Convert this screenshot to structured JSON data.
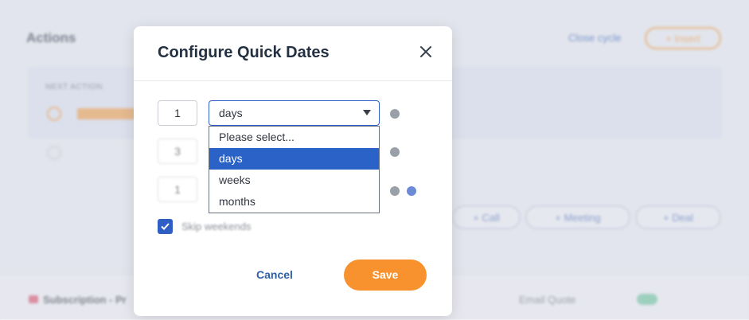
{
  "background": {
    "actions_title": "Actions",
    "close_cycle": "Close cycle",
    "insert": "+ Insert",
    "next_action_label": "NEXT ACTION",
    "pills": [
      "+ Call",
      "+ Meeting",
      "+ Deal"
    ],
    "subscription": "Subscription - Pr",
    "email_quote": "Email Quote"
  },
  "modal": {
    "title": "Configure Quick Dates",
    "close_icon": "close-icon",
    "rows": [
      {
        "number": "1",
        "unit": "days"
      },
      {
        "number": "3"
      },
      {
        "number": "1"
      }
    ],
    "dropdown": {
      "options": [
        "Please select...",
        "days",
        "weeks",
        "months"
      ],
      "selected": "days"
    },
    "skip_weekends": {
      "label": "Skip weekends",
      "checked": true
    },
    "cancel_label": "Cancel",
    "save_label": "Save"
  },
  "colors": {
    "accent_blue": "#2f5fc4",
    "selected_option": "#2b62c8",
    "save_orange": "#f7922e",
    "title_text": "#243142"
  }
}
